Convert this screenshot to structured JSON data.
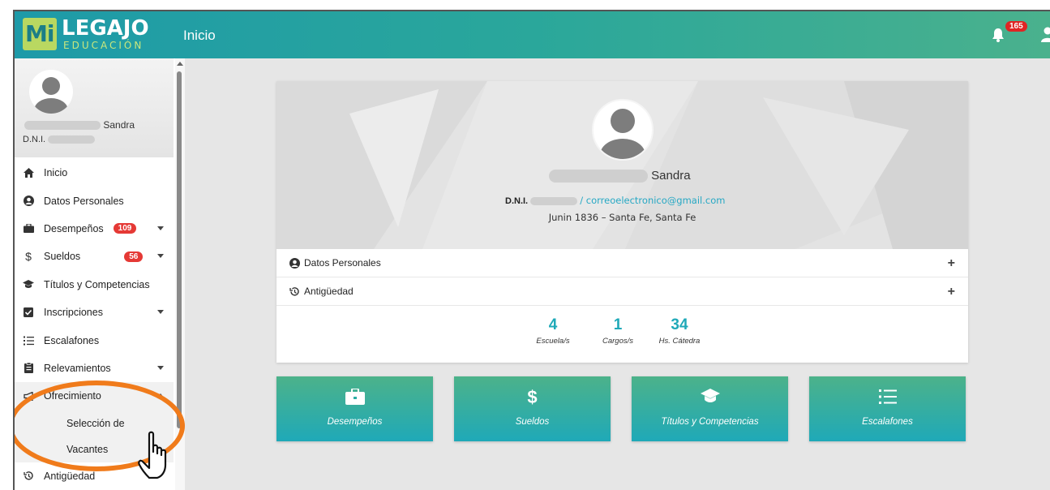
{
  "app": {
    "logo_mi": "Mi",
    "logo_legajo": "LEGAJO",
    "logo_educacion": "EDUCACIÓN",
    "page_title": "Inicio",
    "notification_count": "165"
  },
  "colors": {
    "accent": "#1fa9b8",
    "topbar_start": "#1e9aa8",
    "topbar_end": "#4ab18d",
    "badge_red": "#e53935",
    "annotation_orange": "#f07b1b"
  },
  "sidebar": {
    "profile_name": "Sandra",
    "profile_dni_label": "D.N.I.",
    "items": [
      {
        "label": "Inicio",
        "icon": "home-icon"
      },
      {
        "label": "Datos Personales",
        "icon": "user-circle-icon"
      },
      {
        "label": "Desempeños",
        "icon": "briefcase-icon",
        "badge": "109",
        "caret": "down"
      },
      {
        "label": "Sueldos",
        "icon": "dollar-icon",
        "badge": "56",
        "caret": "down"
      },
      {
        "label": "Títulos y Competencias",
        "icon": "graduation-cap-icon"
      },
      {
        "label": "Inscripciones",
        "icon": "check-square-icon",
        "caret": "down"
      },
      {
        "label": "Escalafones",
        "icon": "list-ol-icon"
      },
      {
        "label": "Relevamientos",
        "icon": "clipboard-icon",
        "caret": "down"
      },
      {
        "label": "Ofrecimiento",
        "icon": "megaphone-icon",
        "caret": "up"
      },
      {
        "label": "Antigüedad",
        "icon": "history-icon"
      }
    ],
    "submenu": [
      "Selección de",
      "Vacantes"
    ]
  },
  "profile_card": {
    "name": "Sandra",
    "dni_label": "D.N.I.",
    "email": "/ correoelectronico@gmail.com",
    "address": "Junin 1836 – Santa Fe, Santa Fe",
    "sections": [
      {
        "label": "Datos Personales",
        "icon": "user-circle-icon"
      },
      {
        "label": "Antigüedad",
        "icon": "history-icon"
      }
    ],
    "expand_symbol": "+",
    "stats": [
      {
        "value": "4",
        "label": "Escuela/s"
      },
      {
        "value": "1",
        "label": "Cargos/s"
      },
      {
        "value": "34",
        "label": "Hs. Cátedra"
      }
    ]
  },
  "tiles": [
    {
      "label": "Desempeños",
      "icon": "briefcase-icon"
    },
    {
      "label": "Sueldos",
      "icon": "dollar-icon"
    },
    {
      "label": "Títulos y Competencias",
      "icon": "graduation-cap-icon"
    },
    {
      "label": "Escalafones",
      "icon": "list-ol-icon"
    }
  ]
}
